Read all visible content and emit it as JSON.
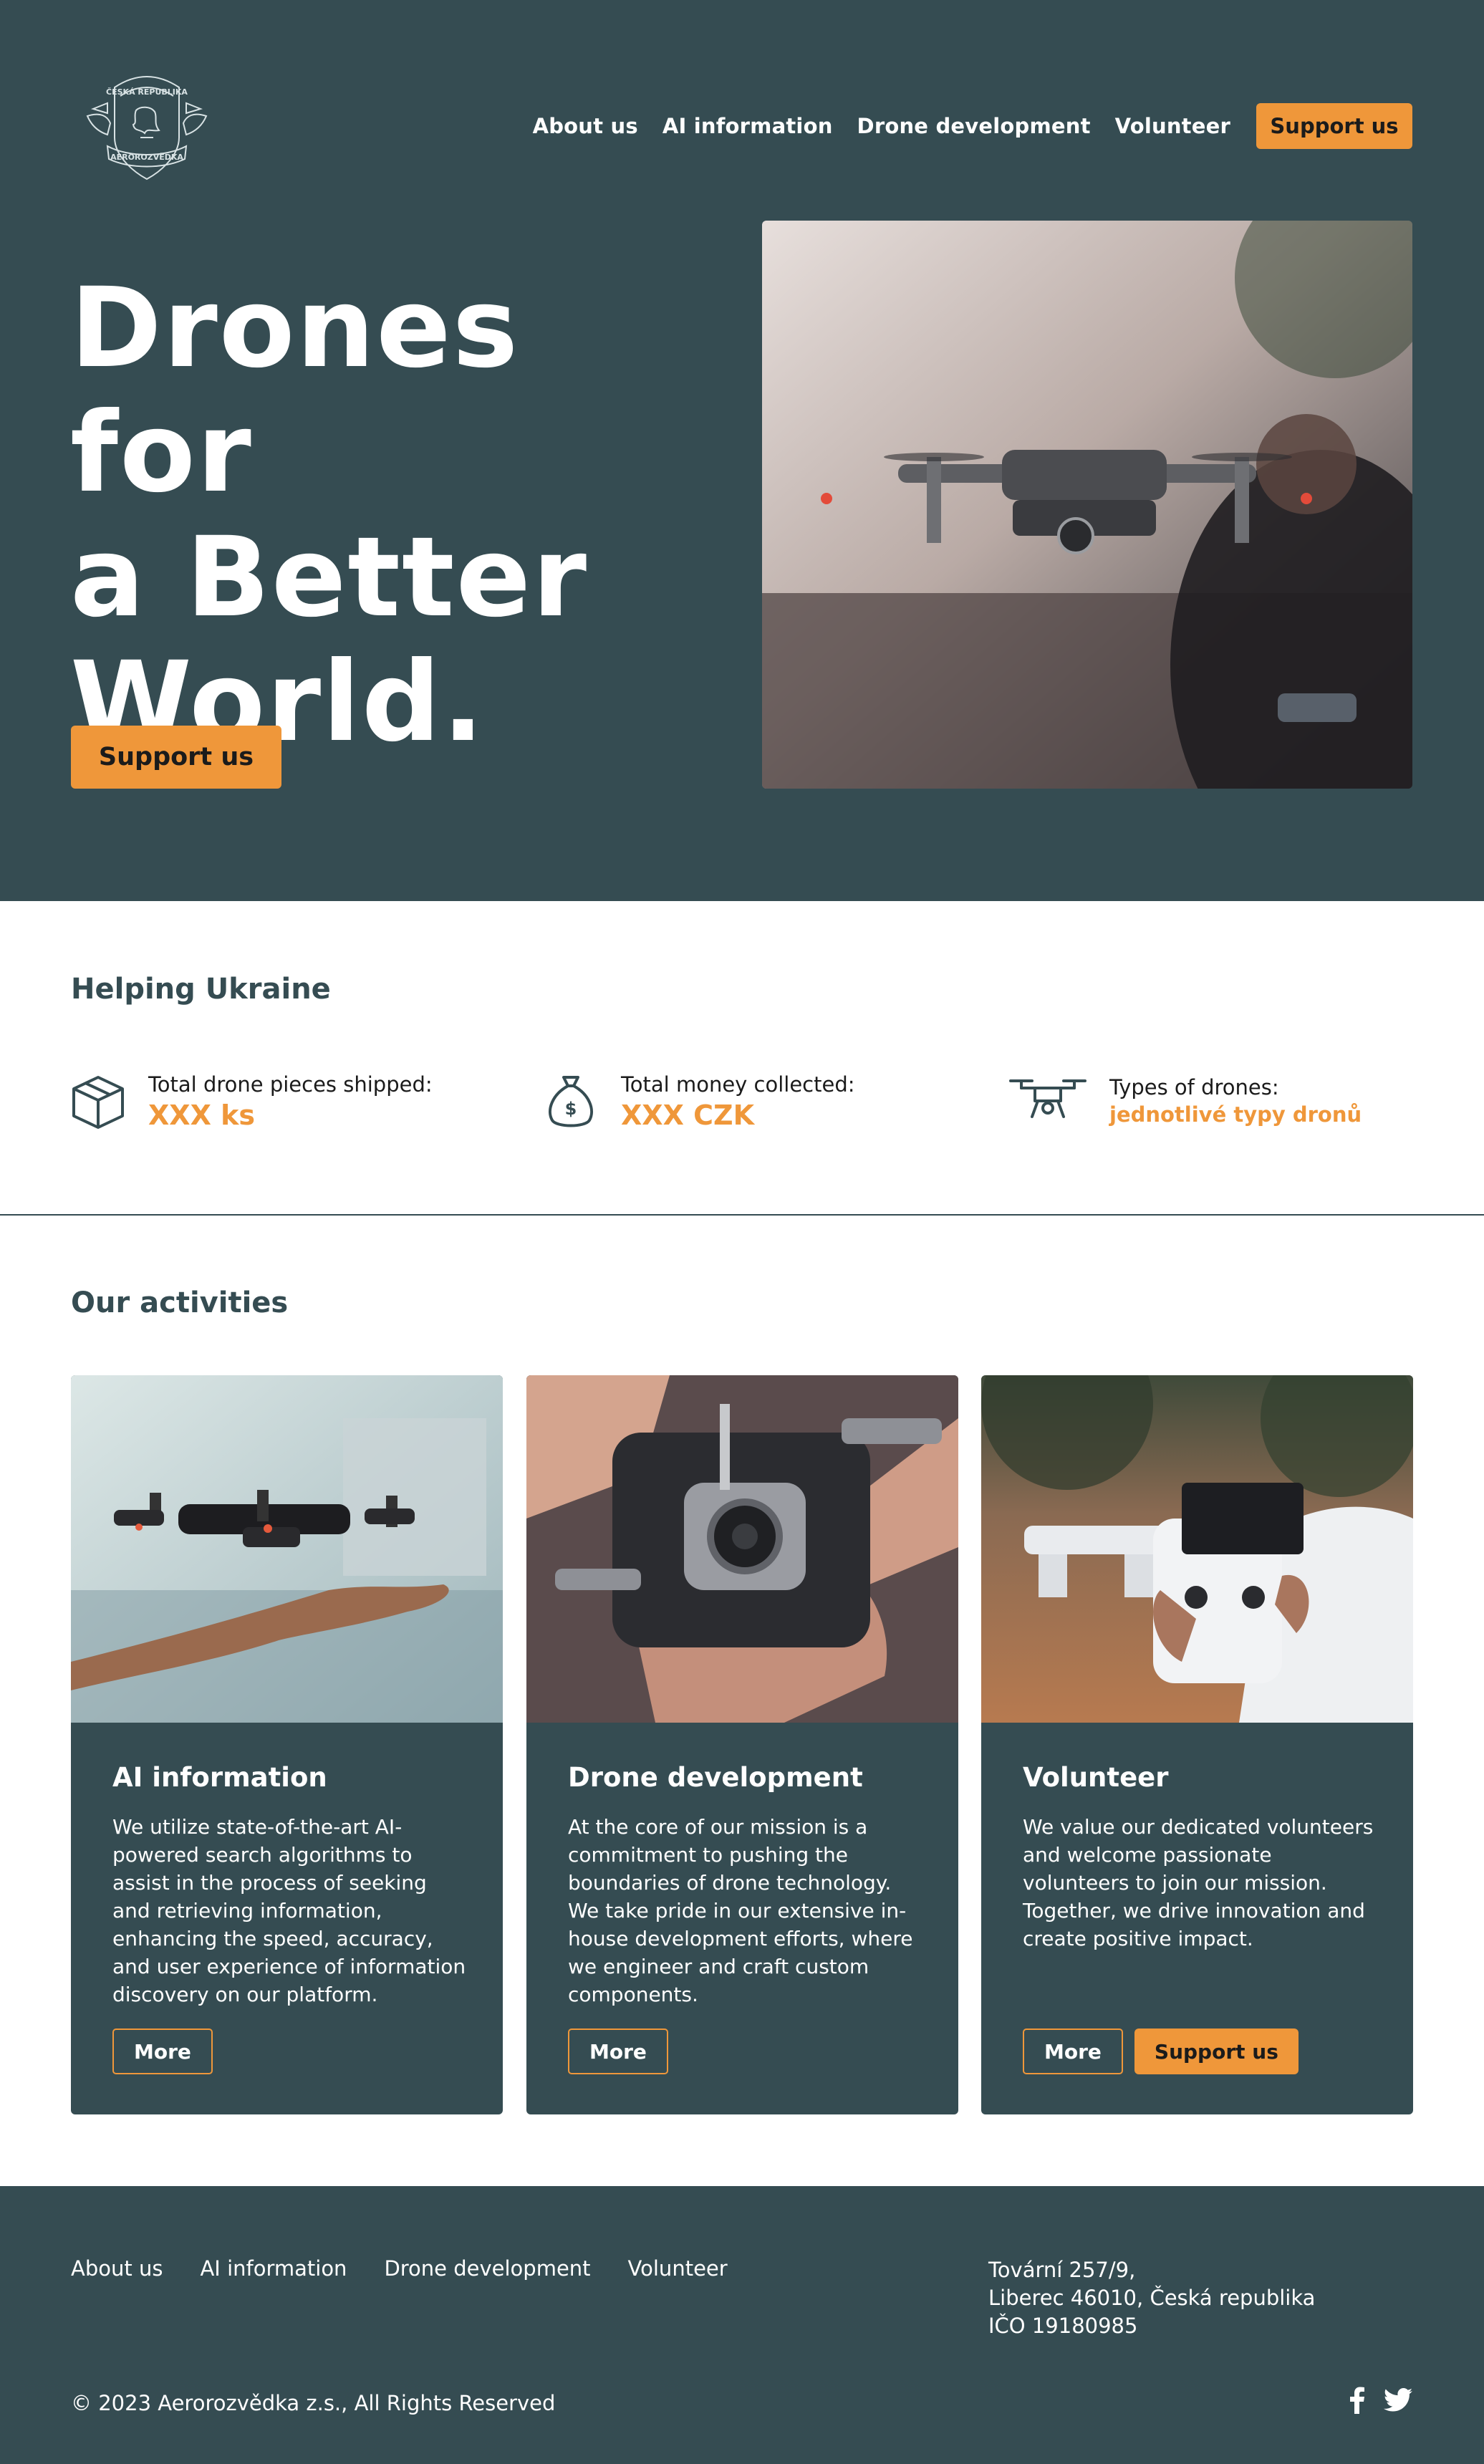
{
  "logo": {
    "top_text": "ČESKÁ REPUBLIKA",
    "bottom_text": "AEROROZVĚDKA"
  },
  "nav": {
    "items": [
      "About us",
      "AI information",
      "Drone development",
      "Volunteer"
    ],
    "cta": "Support us"
  },
  "hero": {
    "title_line1": "Drones for",
    "title_line2": "a Better",
    "title_line3": "World.",
    "cta": "Support us",
    "photo_icon": "drone-photo"
  },
  "helping": {
    "title": "Helping Ukraine",
    "stats": [
      {
        "icon": "box-icon",
        "label": "Total drone pieces shipped:",
        "value": "XXX ks"
      },
      {
        "icon": "money-bag-icon",
        "label": "Total money collected:",
        "value": "XXX CZK"
      },
      {
        "icon": "drone-icon",
        "label": "Types of drones:",
        "value": "jednotlivé typy dronů"
      }
    ]
  },
  "activities": {
    "title": "Our activities",
    "cards": [
      {
        "title": "AI information",
        "text": "We utilize state-of-the-art AI-powered search algorithms to assist in the process of seeking and retrieving information, enhancing the speed, accuracy, and user experience of information discovery on our platform.",
        "more": "More"
      },
      {
        "title": "Drone development",
        "text": "At the core of our mission is a commitment to pushing the boundaries of drone technology. We take pride in our extensive in-house development efforts, where we engineer and craft custom components.",
        "more": "More"
      },
      {
        "title": "Volunteer",
        "text": "We value our dedicated volunteers and welcome passionate volunteers to join our mission. Together, we drive innovation and create positive impact.",
        "more": "More",
        "support": "Support us"
      }
    ]
  },
  "footer": {
    "links": [
      "About us",
      "AI information",
      "Drone development",
      "Volunteer"
    ],
    "address_line1": "Tovární 257/9,",
    "address_line2": "Liberec 46010, Česká republika",
    "address_line3": "IČO 19180985",
    "copyright": "© 2023 Aerorozvědka z.s., All Rights Reserved",
    "social": [
      "facebook-icon",
      "twitter-icon"
    ]
  },
  "colors": {
    "primary": "#354c52",
    "accent": "#ef973a",
    "white": "#ffffff"
  }
}
